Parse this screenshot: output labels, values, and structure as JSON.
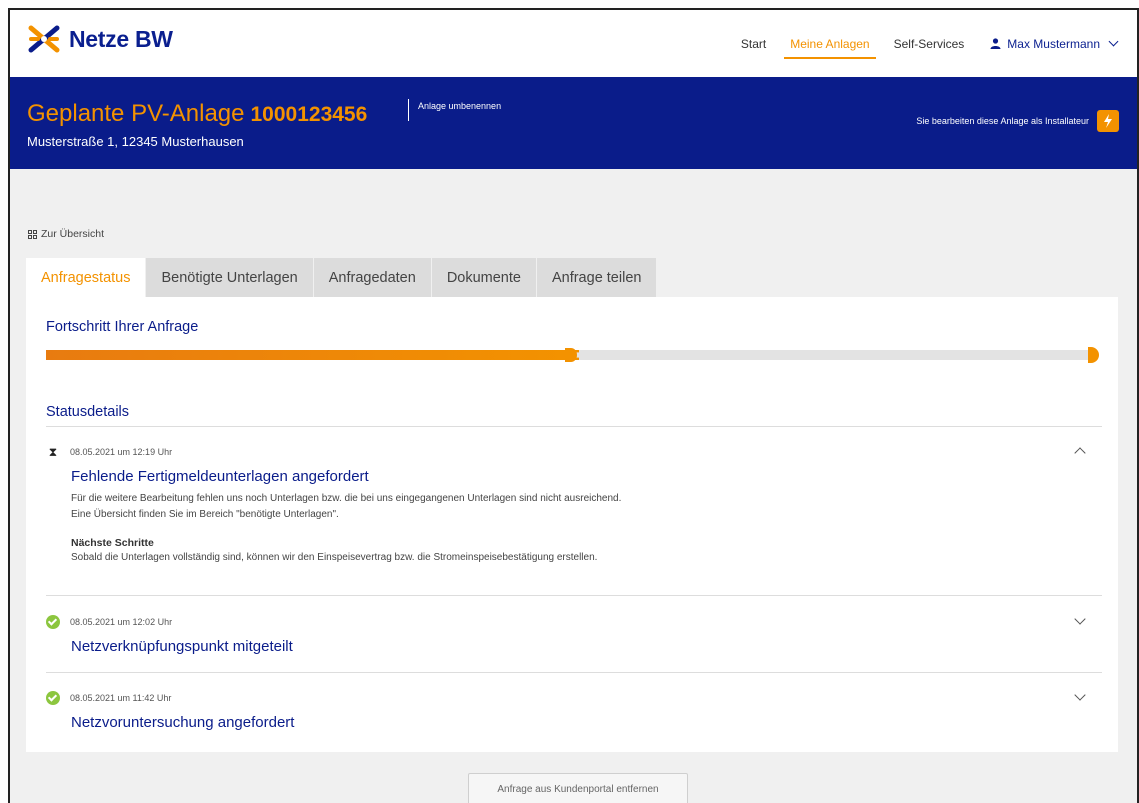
{
  "brand": {
    "name": "Netze BW",
    "accent": "#f39200",
    "primary": "#0a1c8a"
  },
  "nav": {
    "items": [
      {
        "label": "Start",
        "active": false
      },
      {
        "label": "Meine Anlagen",
        "active": true
      },
      {
        "label": "Self-Services",
        "active": false
      }
    ],
    "user": "Max Mustermann",
    "user_icon": "user-icon"
  },
  "banner": {
    "title": "Geplante PV-Anlage",
    "number": "1000123456",
    "address": "Musterstraße 1, 12345 Musterhausen",
    "rename_label": "Anlage umbenennen",
    "installer_note": "Sie bearbeiten diese Anlage als Installateur",
    "installer_icon": "lightning-icon"
  },
  "back_link": "Zur Übersicht",
  "tabs": [
    {
      "label": "Anfragestatus",
      "active": true
    },
    {
      "label": "Benötigte Unterlagen",
      "active": false
    },
    {
      "label": "Anfragedaten",
      "active": false
    },
    {
      "label": "Dokumente",
      "active": false
    },
    {
      "label": "Anfrage teilen",
      "active": false
    }
  ],
  "progress": {
    "label": "Fortschritt Ihrer Anfrage",
    "value_fraction": 0.5
  },
  "status": {
    "label": "Statusdetails",
    "items": [
      {
        "icon": "hourglass-icon",
        "timestamp": "08.05.2021 um 12:19 Uhr",
        "title": "Fehlende Fertigmeldeunterlagen angefordert",
        "expanded": true,
        "text_1": "Für die weitere Bearbeitung fehlen uns noch Unterlagen bzw. die bei uns eingegangenen Unterlagen sind nicht ausreichend.",
        "text_2": "Eine Übersicht finden Sie im Bereich \"benötigte Unterlagen\".",
        "next_heading": "Nächste Schritte",
        "next_text": "Sobald die Unterlagen vollständig sind, können wir den Einspeisevertrag bzw. die Stromeinspeisebestätigung erstellen."
      },
      {
        "icon": "check-icon",
        "timestamp": "08.05.2021 um 12:02 Uhr",
        "title": "Netzverknüpfungspunkt mitgeteilt",
        "expanded": false
      },
      {
        "icon": "check-icon",
        "timestamp": "08.05.2021 um 11:42 Uhr",
        "title": "Netzvoruntersuchung angefordert",
        "expanded": false
      }
    ]
  },
  "remove_button": "Anfrage aus Kundenportal entfernen"
}
